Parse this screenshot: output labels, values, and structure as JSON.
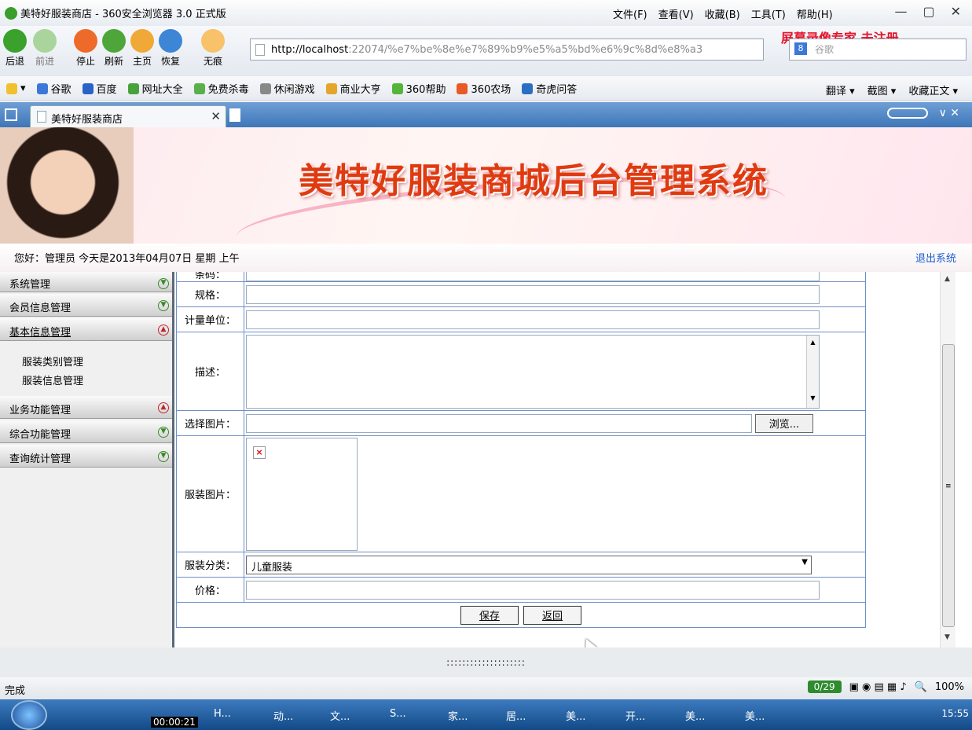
{
  "browser": {
    "title": "美特好服装商店 - 360安全浏览器 3.0 正式版",
    "menus": [
      "文件(F)",
      "查看(V)",
      "收藏(B)",
      "工具(T)",
      "帮助(H)"
    ],
    "nav": [
      "后退",
      "前进",
      "停止",
      "刷新",
      "主页",
      "恢复",
      "无痕"
    ],
    "address_host": "http://localhost",
    "address_rest": ":22074/%e7%be%8e%e7%89%b9%e5%a5%bd%e6%9c%8d%e8%a3",
    "search_placeholder": "谷歌",
    "watermark": "屏幕录像专家  未注册",
    "favorites": [
      "谷歌",
      "百度",
      "网址大全",
      "免费杀毒",
      "休闲游戏",
      "商业大亨",
      "360帮助",
      "360农场",
      "奇虎问答"
    ],
    "fav_right": [
      "翻译",
      "截图",
      "收藏正文"
    ],
    "tab_label": "美特好服装商店"
  },
  "page": {
    "banner_title": "美特好服装商城后台管理系统",
    "greeting": "您好：管理员  今天是2013年04月07日  星期  上午",
    "logout": "退出系统",
    "sidebar": {
      "menus": [
        "系统管理",
        "会员信息管理",
        "基本信息管理"
      ],
      "submenu": [
        "服装类别管理",
        "服装信息管理"
      ],
      "menus_after": [
        "业务功能管理",
        "综合功能管理",
        "查询统计管理"
      ]
    },
    "form": {
      "barcode_label": "条码：",
      "spec_label": "规格：",
      "unit_label": "计量单位：",
      "desc_label": "描述：",
      "choose_image_label": "选择图片：",
      "browse_button": "浏览...",
      "image_label": "服装图片：",
      "category_label": "服装分类：",
      "category_value": "儿童服装",
      "price_label": "价格：",
      "save_button": "保存",
      "back_button": "返回"
    }
  },
  "statusbar": {
    "status": "完成",
    "counter": "0/29",
    "zoom": "100%"
  },
  "taskbar": {
    "timer": "00:00:21",
    "tasks": [
      "H...",
      "动...",
      "文...",
      "S...",
      "家...",
      "居...",
      "美...",
      "开...",
      "美...",
      "美..."
    ],
    "clock": "15:55"
  }
}
